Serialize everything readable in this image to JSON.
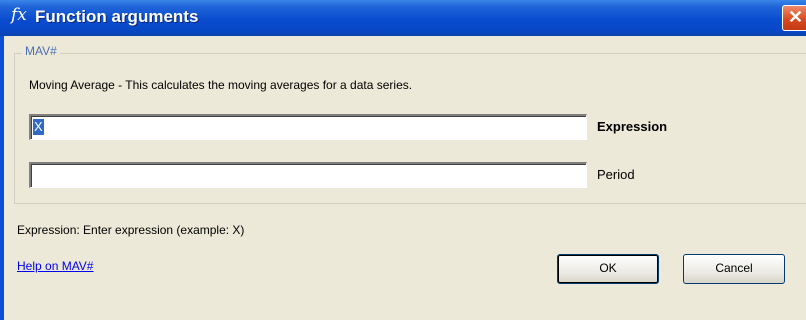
{
  "titlebar": {
    "icon": "fx-icon",
    "icon_text": "fx",
    "title": "Function arguments",
    "close_symbol": "✕"
  },
  "group": {
    "legend": "MAV#",
    "description": "Moving Average - This calculates the moving averages for a data series.",
    "arguments": [
      {
        "label": "Expression",
        "value": "X",
        "selected": true,
        "active": true
      },
      {
        "label": "Period",
        "value": ""
      }
    ]
  },
  "hint": "Expression: Enter expression (example: X)",
  "help_link": "Help on  MAV#",
  "buttons": {
    "ok": "OK",
    "cancel": "Cancel"
  },
  "colors": {
    "titlebar": "#0a4ccf",
    "selection": "#316ac5",
    "link": "#0000ee",
    "close": "#d7451c"
  }
}
